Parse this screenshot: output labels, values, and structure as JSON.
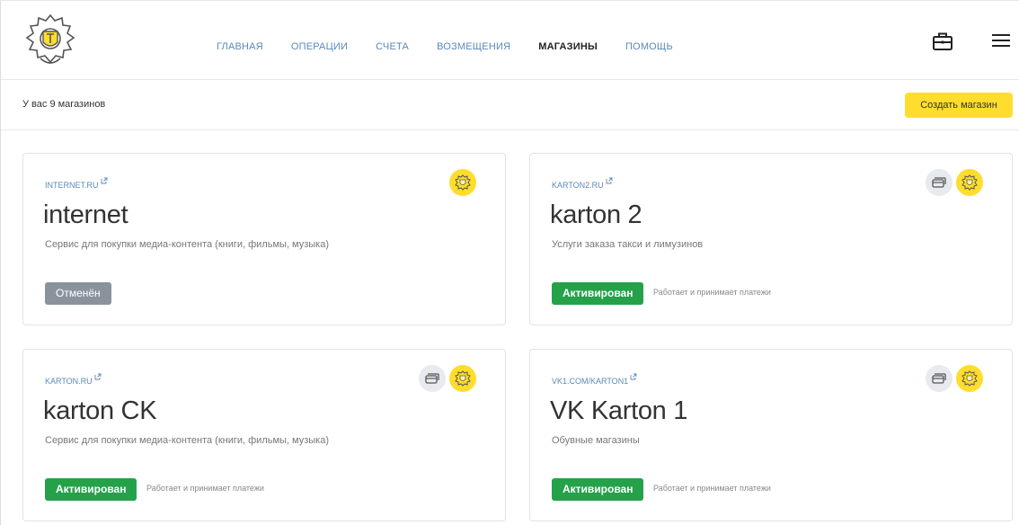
{
  "header": {
    "nav": [
      {
        "label": "ГЛАВНАЯ",
        "active": false
      },
      {
        "label": "ОПЕРАЦИИ",
        "active": false
      },
      {
        "label": "СЧЕТА",
        "active": false
      },
      {
        "label": "ВОЗМЕЩЕНИЯ",
        "active": false
      },
      {
        "label": "МАГАЗИНЫ",
        "active": true
      },
      {
        "label": "ПОМОЩЬ",
        "active": false
      }
    ],
    "icons": [
      "briefcase-icon",
      "menu-icon"
    ]
  },
  "subheader": {
    "count_text": "У вас 9 магазинов",
    "create_button": "Создать магазин"
  },
  "stores": [
    {
      "link": "INTERNET.RU",
      "title": "internet",
      "description": "Сервис для покупки медиа-контента (книги, фильмы, музыка)",
      "status": "Отменён",
      "status_color": "#8a939c",
      "status_note": ""
    },
    {
      "link": "KARTON2.RU",
      "title": "karton 2",
      "description": "Услуги заказа такси и лимузинов",
      "status": "Активирован",
      "status_color": "#25a14a",
      "status_note": "Работает и принимает платежи"
    },
    {
      "link": "KARTON.RU",
      "title": "karton CK",
      "description": "Сервис для покупки медиа-контента (книги, фильмы, музыка)",
      "status": "Активирован",
      "status_color": "#25a14a",
      "status_note": "Работает и принимает платежи"
    },
    {
      "link": "VK1.COM/KARTON1",
      "title": "VK Karton 1",
      "description": "Обувные магазины",
      "status": "Активирован",
      "status_color": "#25a14a",
      "status_note": "Работает и принимает платежи"
    }
  ],
  "colors": {
    "accent_yellow": "#ffdd2d",
    "link_blue": "#5a8ab8",
    "active_green": "#25a14a",
    "cancelled_gray": "#8a939c"
  }
}
